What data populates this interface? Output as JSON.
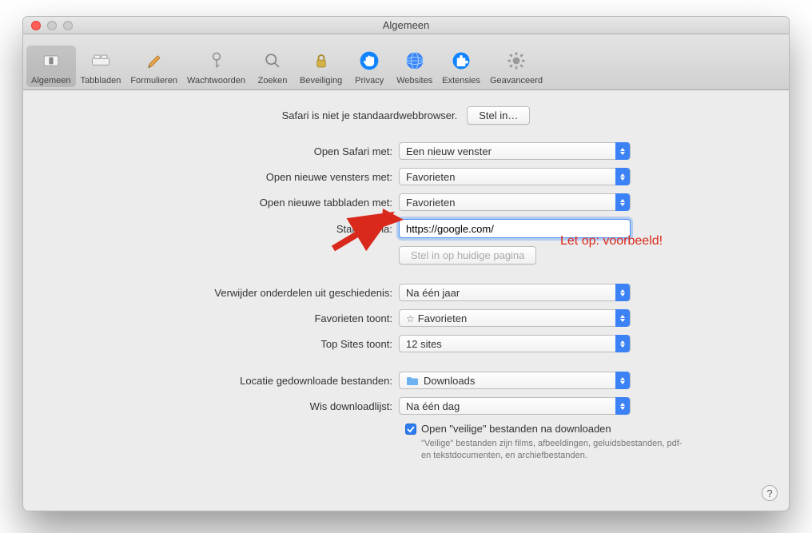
{
  "window": {
    "title": "Algemeen"
  },
  "toolbar": {
    "items": [
      {
        "label": "Algemeen"
      },
      {
        "label": "Tabbladen"
      },
      {
        "label": "Formulieren"
      },
      {
        "label": "Wachtwoorden"
      },
      {
        "label": "Zoeken"
      },
      {
        "label": "Beveiliging"
      },
      {
        "label": "Privacy"
      },
      {
        "label": "Websites"
      },
      {
        "label": "Extensies"
      },
      {
        "label": "Geavanceerd"
      }
    ]
  },
  "banner": {
    "text": "Safari is niet je standaardwebbrowser.",
    "button": "Stel in…"
  },
  "rows": {
    "open_safari_met": {
      "label": "Open Safari met:",
      "value": "Een nieuw venster"
    },
    "open_nieuwe_vensters": {
      "label": "Open nieuwe vensters met:",
      "value": "Favorieten"
    },
    "open_nieuwe_tabbladen": {
      "label": "Open nieuwe tabbladen met:",
      "value": "Favorieten"
    },
    "startpagina": {
      "label": "Startpagina:",
      "value": "https://google.com/"
    },
    "stel_in_huidige": "Stel in op huidige pagina",
    "verwijder_geschiedenis": {
      "label": "Verwijder onderdelen uit geschiedenis:",
      "value": "Na één jaar"
    },
    "favorieten_toont": {
      "label": "Favorieten toont:",
      "value": "Favorieten"
    },
    "top_sites": {
      "label": "Top Sites toont:",
      "value": "12 sites"
    },
    "locatie_downloads": {
      "label": "Locatie gedownloade bestanden:",
      "value": "Downloads"
    },
    "wis_downloadlijst": {
      "label": "Wis downloadlijst:",
      "value": "Na één dag"
    }
  },
  "checkbox": {
    "label": "Open \"veilige\" bestanden na downloaden",
    "help": "\"Veilige\" bestanden zijn films, afbeeldingen, geluidsbestanden, pdf- en tekstdocumenten, en archiefbestanden."
  },
  "annotation": "Let op: voorbeeld!",
  "colors": {
    "accent": "#d9291c"
  }
}
